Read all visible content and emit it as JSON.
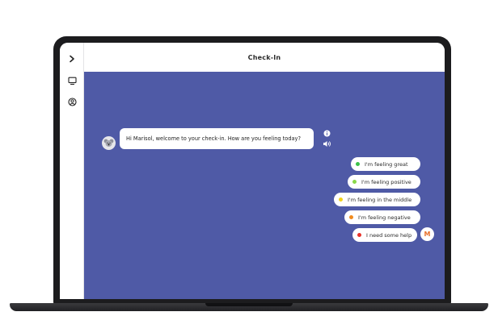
{
  "header": {
    "title": "Check-In"
  },
  "sidebar": {
    "items": [
      {
        "icon": "chevron-right-icon"
      },
      {
        "icon": "monitor-icon"
      },
      {
        "icon": "user-circle-icon"
      }
    ]
  },
  "chat": {
    "bot_message": "Hi Marisol, welcome to your check-in. How are you feeling today?",
    "options": [
      {
        "label": "I'm feeling great",
        "color": "#3cc24a"
      },
      {
        "label": "I'm feeling positive",
        "color": "#8ad84a"
      },
      {
        "label": "I'm feeling in the middle",
        "color": "#f2d21b"
      },
      {
        "label": "I'm feeling negative",
        "color": "#f08a1e"
      },
      {
        "label": "I need some help",
        "color": "#e8322a"
      }
    ],
    "user_avatar_initial": "M"
  },
  "colors": {
    "chat_background": "#4f5aa6",
    "bezel": "#1c1c1e",
    "user_avatar_accent": "#e8702a"
  }
}
